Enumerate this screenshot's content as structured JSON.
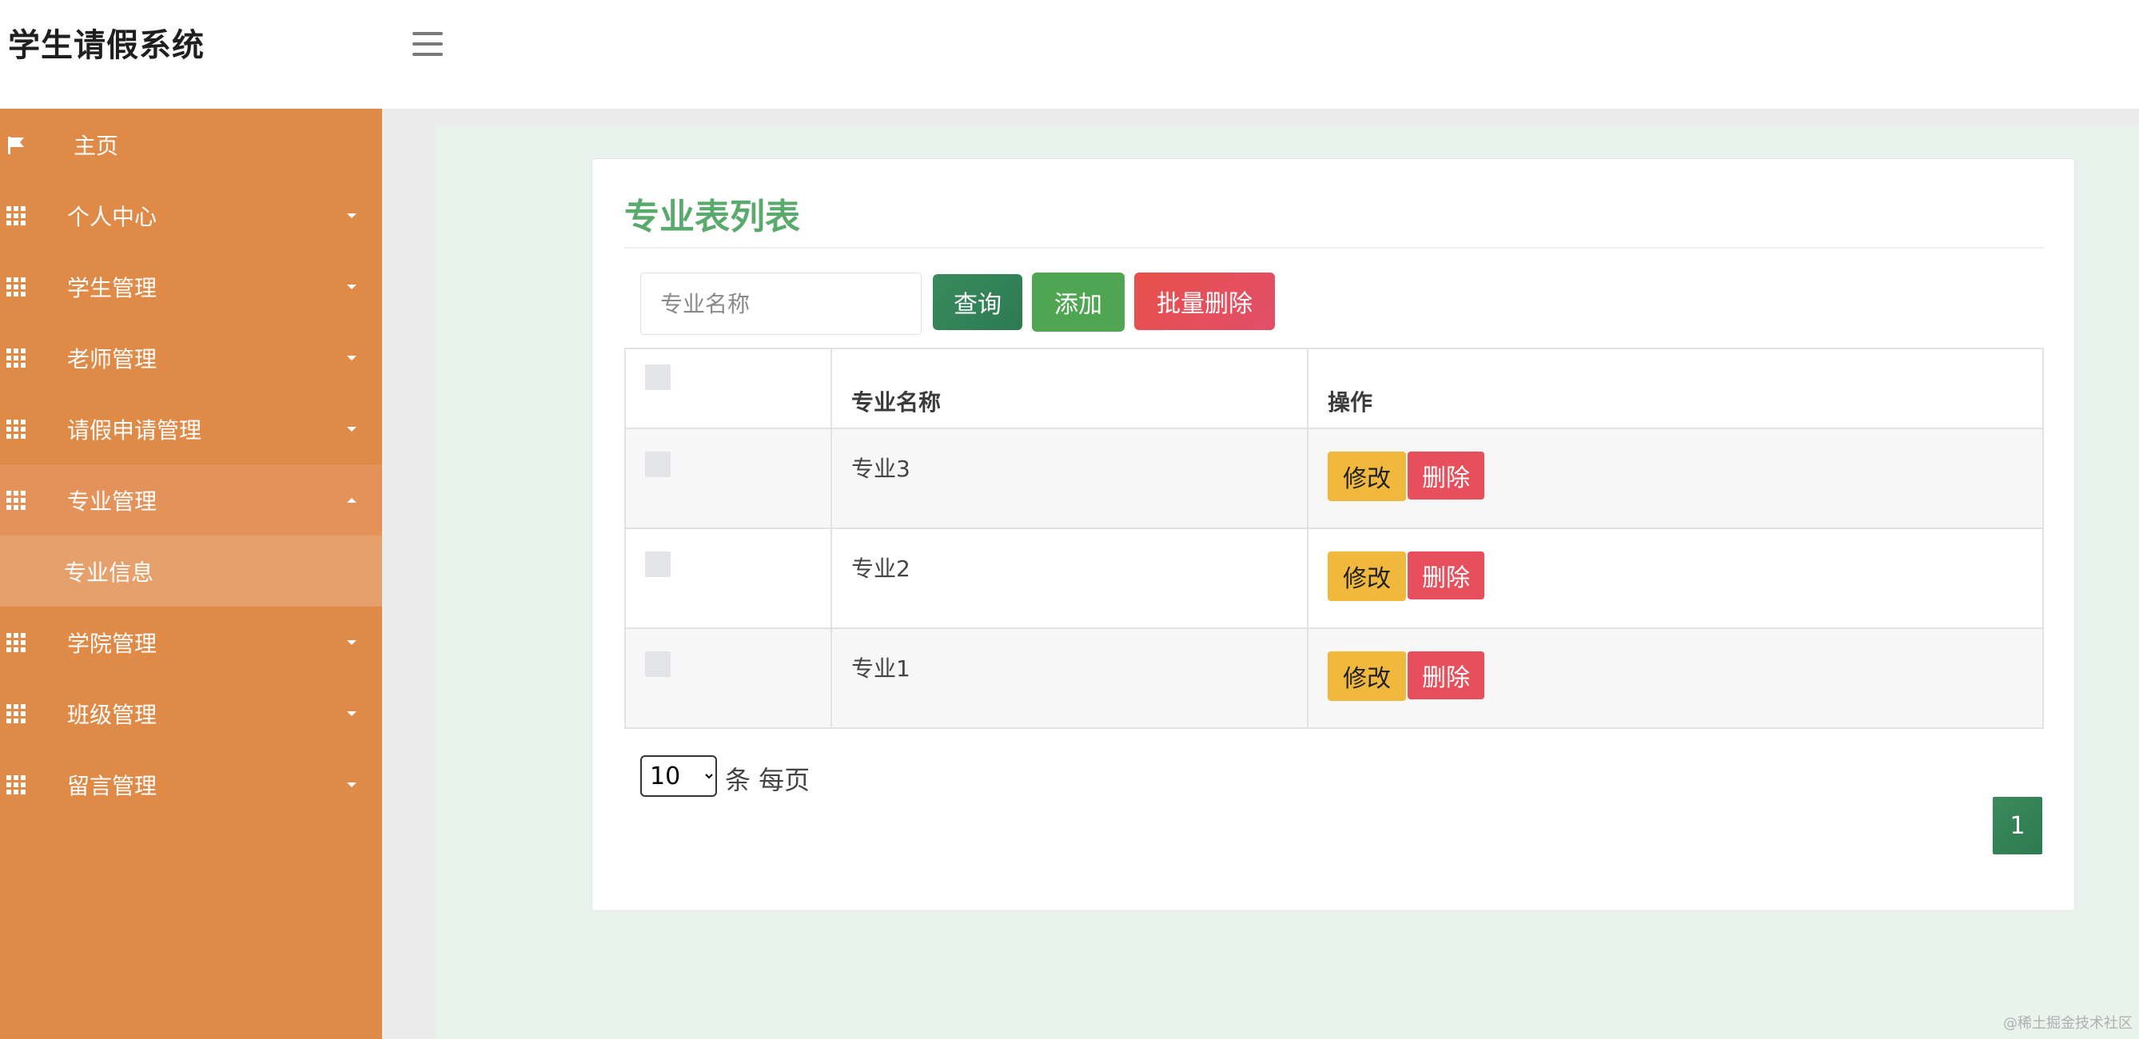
{
  "app": {
    "title": "学生请假系统"
  },
  "sidebar": {
    "items": [
      {
        "label": "主页",
        "icon": "flag-icon"
      },
      {
        "label": "个人中心",
        "icon": "grid-icon"
      },
      {
        "label": "学生管理",
        "icon": "grid-icon"
      },
      {
        "label": "老师管理",
        "icon": "grid-icon"
      },
      {
        "label": "请假申请管理",
        "icon": "grid-icon"
      },
      {
        "label": "专业管理",
        "icon": "grid-icon",
        "expanded": true,
        "children": [
          {
            "label": "专业信息"
          }
        ]
      },
      {
        "label": "学院管理",
        "icon": "grid-icon"
      },
      {
        "label": "班级管理",
        "icon": "grid-icon"
      },
      {
        "label": "留言管理",
        "icon": "grid-icon"
      }
    ]
  },
  "main": {
    "title": "专业表列表",
    "search": {
      "placeholder": "专业名称",
      "value": ""
    },
    "buttons": {
      "query": "查询",
      "add": "添加",
      "batch_delete": "批量删除"
    },
    "table": {
      "headers": [
        "",
        "专业名称",
        "操作"
      ],
      "rows": [
        {
          "name": "专业3",
          "edit": "修改",
          "delete": "删除"
        },
        {
          "name": "专业2",
          "edit": "修改",
          "delete": "删除"
        },
        {
          "name": "专业1",
          "edit": "修改",
          "delete": "删除"
        }
      ]
    },
    "pagination": {
      "page_size": "10",
      "page_size_suffix": "条 每页",
      "current_page": "1"
    }
  },
  "watermark": "@稀土掘金技术社区",
  "colors": {
    "sidebar": "#e08a48",
    "title_green": "#5aaa6e",
    "query": "#2c7a52",
    "add": "#4fa552",
    "danger": "#e64f5b",
    "edit": "#f0b93e"
  }
}
